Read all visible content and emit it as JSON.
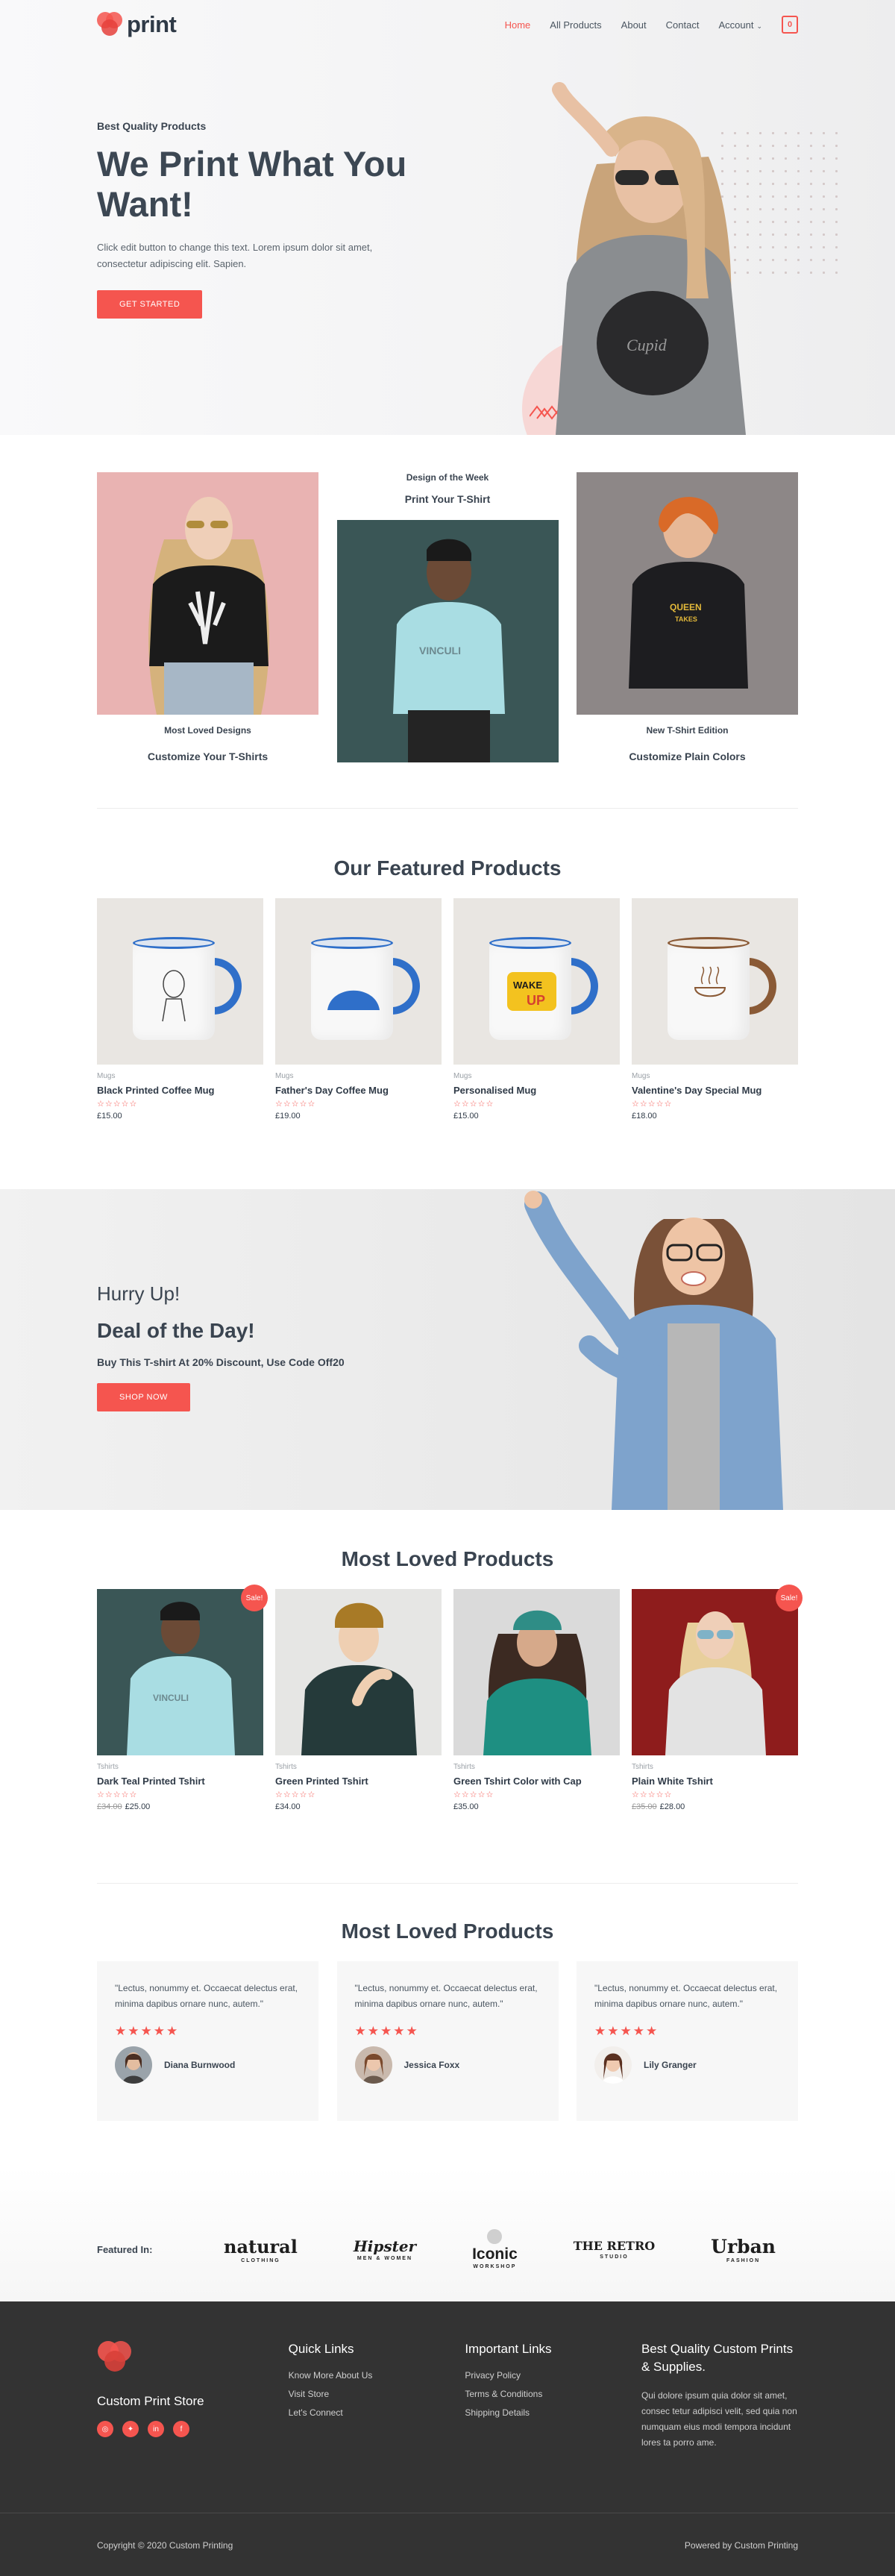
{
  "header": {
    "logo_text": "print",
    "nav": [
      {
        "label": "Home",
        "active": true
      },
      {
        "label": "All Products"
      },
      {
        "label": "About"
      },
      {
        "label": "Contact"
      },
      {
        "label": "Account"
      }
    ],
    "cart_count": "0"
  },
  "hero": {
    "eyebrow": "Best Quality Products",
    "title": "We Print What You Want!",
    "desc": "Click edit button to change this text. Lorem ipsum dolor sit amet, consectetur adipiscing elit. Sapien.",
    "button": "GET STARTED"
  },
  "designs": {
    "left": {
      "caption": "Most Loved Designs",
      "sub": "Customize Your T-Shirts"
    },
    "mid": {
      "caption": "Design of the Week",
      "sub": "Print Your T-Shirt"
    },
    "right": {
      "caption": "New T-Shirt Edition",
      "sub": "Customize Plain Colors"
    }
  },
  "featured": {
    "title": "Our Featured Products",
    "products": [
      {
        "category": "Mugs",
        "name": "Black Printed Coffee Mug",
        "price": "£15.00",
        "rating": 0
      },
      {
        "category": "Mugs",
        "name": "Father's Day Coffee Mug",
        "price": "£19.00",
        "rating": 0
      },
      {
        "category": "Mugs",
        "name": "Personalised Mug",
        "price": "£15.00",
        "rating": 0
      },
      {
        "category": "Mugs",
        "name": "Valentine's Day Special Mug",
        "price": "£18.00",
        "rating": 0
      }
    ]
  },
  "deal": {
    "h1": "Hurry Up!",
    "h2": "Deal of the Day!",
    "text": "Buy This T-shirt At 20% Discount, Use Code Off20",
    "button": "SHOP NOW"
  },
  "loved": {
    "title": "Most Loved Products",
    "sale_label": "Sale!",
    "products": [
      {
        "category": "Tshirts",
        "name": "Dark Teal Printed Tshirt",
        "old_price": "£34.00",
        "price": "£25.00",
        "sale": true
      },
      {
        "category": "Tshirts",
        "name": "Green Printed Tshirt",
        "old_price": "",
        "price": "£34.00",
        "sale": false
      },
      {
        "category": "Tshirts",
        "name": "Green Tshirt Color with Cap",
        "old_price": "",
        "price": "£35.00",
        "sale": false
      },
      {
        "category": "Tshirts",
        "name": "Plain White Tshirt",
        "old_price": "£35.00",
        "price": "£28.00",
        "sale": true
      }
    ]
  },
  "testimonials": {
    "title": "Most Loved Products",
    "items": [
      {
        "quote": "\"Lectus, nonummy et. Occaecat delectus erat, minima dapibus ornare nunc, autem.\"",
        "author": "Diana Burnwood",
        "stars": "★★★★★"
      },
      {
        "quote": "\"Lectus, nonummy et. Occaecat delectus erat, minima dapibus ornare nunc, autem.\"",
        "author": "Jessica Foxx",
        "stars": "★★★★★"
      },
      {
        "quote": "\"Lectus, nonummy et. Occaecat delectus erat, minima dapibus ornare nunc, autem.\"",
        "author": "Lily Granger",
        "stars": "★★★★★"
      }
    ]
  },
  "featured_in": {
    "label": "Featured In:",
    "brands": [
      {
        "name": "natural",
        "tag": "CLOTHING"
      },
      {
        "name": "Hipster",
        "tag": "MEN & WOMEN"
      },
      {
        "name": "Iconic",
        "tag": "WORKSHOP"
      },
      {
        "name": "THE RETRO",
        "tag": "STUDIO"
      },
      {
        "name": "Urban",
        "tag": "FASHION"
      }
    ]
  },
  "footer": {
    "store_name": "Custom Print Store",
    "quick_links_title": "Quick Links",
    "quick_links": [
      "Know More About Us",
      "Visit Store",
      "Let's Connect"
    ],
    "important_title": "Important Links",
    "important_links": [
      "Privacy Policy",
      "Terms & Conditions",
      "Shipping Details"
    ],
    "about_title": "Best Quality Custom Prints & Supplies.",
    "about_text": "Qui dolore ipsum quia dolor sit amet, consec tetur adipisci velit, sed quia non numquam eius modi tempora incidunt lores ta porro ame.",
    "copyright": "Copyright © 2020 Custom Printing",
    "powered": "Powered by Custom Printing"
  },
  "colors": {
    "accent": "#f5554f",
    "text": "#3a4450",
    "footer_bg": "#333333"
  }
}
